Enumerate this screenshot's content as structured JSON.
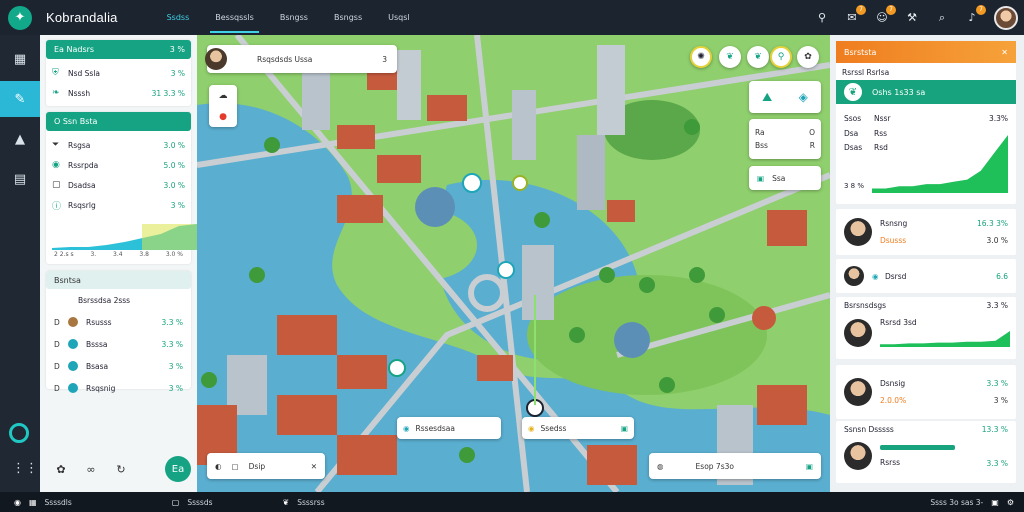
{
  "app": {
    "title": "Kobrandalia"
  },
  "nav": {
    "tabs": [
      "Ssdss",
      "Bessqssls",
      "Bsngss",
      "Bsngss",
      "Usqsl"
    ]
  },
  "colors": {
    "brand": "#16a384",
    "accent": "#3fd1e6",
    "warning": "#ef7d1f",
    "topbar": "#1c2430"
  },
  "topbar_icons": [
    {
      "icon": "pin-icon",
      "badge": ""
    },
    {
      "icon": "message-icon",
      "badge": "7"
    },
    {
      "icon": "user-icon",
      "badge": "7"
    },
    {
      "icon": "tool-icon",
      "badge": ""
    },
    {
      "icon": "search-icon",
      "badge": ""
    },
    {
      "icon": "bell-icon",
      "badge": "7"
    }
  ],
  "rail": {
    "items": [
      "grid-icon",
      "edit-icon",
      "home-icon",
      "document-icon"
    ],
    "active": 1
  },
  "left": {
    "card1": {
      "title": "Ea Nadsrs",
      "value": "3 %",
      "rows": [
        {
          "icon": "shield-icon",
          "label": "Nsd Ssla",
          "value": "3 %"
        },
        {
          "icon": "leaf-icon",
          "label": "Nsssh",
          "value": "31 3.3 %"
        }
      ]
    },
    "card2": {
      "title": "O Ssn Bsta",
      "rows": [
        {
          "icon": "filter-icon",
          "label": "Rsgsa",
          "value": "3.0 %"
        },
        {
          "icon": "location-icon",
          "label": "Rssrpda",
          "value": "5.0 %"
        },
        {
          "icon": "grid-icon",
          "label": "Dsadsa",
          "value": "3.0 %"
        },
        {
          "icon": "info-icon",
          "label": "Rsqsrlg",
          "value": "3 %"
        }
      ],
      "spark": {
        "values": [
          2,
          3,
          3,
          5,
          8,
          12,
          16,
          24,
          26
        ],
        "axis": [
          "2 2.s s",
          "3.",
          "3.4",
          "3.8",
          "3.0 %"
        ]
      }
    },
    "card3": {
      "title": "Bsntsa",
      "rows": [
        {
          "d": "",
          "label": "Bsrssdsa 2sss",
          "value": "",
          "pic": false
        },
        {
          "d": "D",
          "label": "Rsusss",
          "value": "3.3 %",
          "pic": true
        },
        {
          "d": "D",
          "label": "Bsssa",
          "value": "3.3 %",
          "pic": true
        },
        {
          "d": "D",
          "label": "Bsasa",
          "value": "3 %",
          "pic": true
        },
        {
          "d": "D",
          "label": "Rsqsnig",
          "value": "3 %",
          "pic": true
        }
      ]
    },
    "bottom": {
      "go_label": "Ea"
    }
  },
  "map": {
    "search": {
      "text": "Rsqsdsds Ussa",
      "value": "3"
    },
    "top_buttons": [
      "compass-icon",
      "leaf-icon",
      "leaf-icon",
      "pin-icon",
      "leaf-icon"
    ],
    "layer_buttons": [
      "route-icon",
      "target-icon"
    ],
    "info_chip": {
      "rows": [
        [
          "Ra",
          "O"
        ],
        [
          "Bss",
          "R"
        ]
      ]
    },
    "layer_chip": {
      "text": "Ssa"
    },
    "markers": [
      {
        "label": "Rssesdsaa"
      },
      {
        "label": "Ssedss"
      }
    ],
    "bottom_left": {
      "text": "Dsip"
    },
    "bottom_right": {
      "text": "Esop 7s3o"
    }
  },
  "right": {
    "header": {
      "title": "Bsrststa"
    },
    "subheader": "Rsrssl Rsrlsa",
    "band": {
      "label": "Oshs 1s33 sa"
    },
    "stats": {
      "rows": [
        {
          "label": "Ssos",
          "bar": "Nssr",
          "value": "3.3%"
        },
        {
          "label": "Dsa",
          "bar": "Rss",
          "value": ""
        },
        {
          "label": "Dsas",
          "bar": "Rsd",
          "value": ""
        }
      ],
      "chart": [
        2,
        2,
        3,
        3,
        4,
        4,
        5,
        6,
        10,
        18,
        26
      ],
      "axis_label": "3 8 %"
    },
    "people": [
      {
        "name": "Rsnsng",
        "sub": "Dsusss",
        "value": "16.3 3%",
        "value2": "3.0 %",
        "value2_color": "orange"
      },
      {
        "name": "",
        "sub": "Dsrsd",
        "value": "",
        "value2": "6.6",
        "value2_color": "green"
      },
      {
        "name": "Bsrsnsdsgs",
        "sub": "Rsrsd 3sd",
        "value": "3.3 %",
        "value2": "",
        "value2_color": "green"
      },
      {
        "name": "Dsnsig",
        "sub": "2.0.0%",
        "value": "3.3 %",
        "value2": "3 %",
        "value2_color": "orange"
      },
      {
        "name": "Ssnsn Dsssss",
        "sub": "Rsrss",
        "value": "13.3 %",
        "value2": "3.3 %",
        "value2_color": "green"
      }
    ]
  },
  "status": {
    "items": [
      "Ssssdls",
      "Ssssds",
      "Ssssrss"
    ],
    "right": "Ssss 3o sas 3-"
  }
}
